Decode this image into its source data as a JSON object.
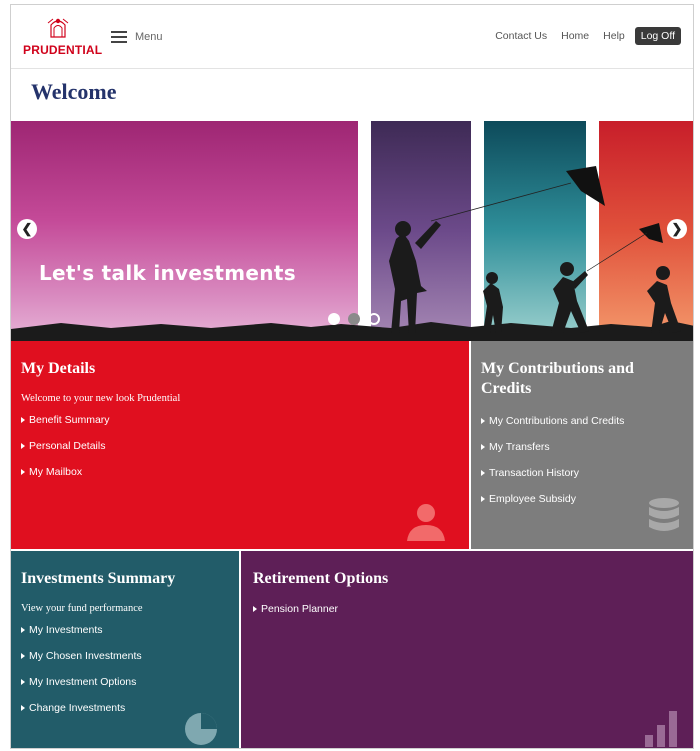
{
  "header": {
    "logo_text": "PRUDENTIAL",
    "menu_label": "Menu",
    "nav": [
      "Contact Us",
      "Home",
      "Help"
    ],
    "logoff_label": "Log Off"
  },
  "page_title": "Welcome",
  "banner": {
    "text": "Let's talk investments",
    "prev_icon": "arrow-left-circle-icon",
    "next_icon": "arrow-right-circle-icon"
  },
  "tiles": {
    "my_details": {
      "title": "My Details",
      "intro": "Welcome to your new look Prudential",
      "links": [
        "Benefit Summary",
        "Personal Details",
        "My Mailbox"
      ],
      "icon": "user-icon"
    },
    "contributions": {
      "title": "My Contributions and Credits",
      "links": [
        "My Contributions and Credits",
        "My Transfers",
        "Transaction History",
        "Employee Subsidy"
      ],
      "icon": "database-icon"
    },
    "investments": {
      "title": "Investments Summary",
      "intro": "View your fund performance",
      "links": [
        "My Investments",
        "My Chosen Investments",
        "My Investment Options",
        "Change Investments"
      ],
      "icon": "pie-chart-icon"
    },
    "retirement": {
      "title": "Retirement Options",
      "links": [
        "Pension Planner"
      ],
      "icon": "bar-chart-icon"
    }
  },
  "colors": {
    "brand_red": "#d0021b",
    "title_navy": "#24336b",
    "details_red": "#e00f1f",
    "contrib_gray": "#7d7d7d",
    "invest_teal": "#225c69",
    "retire_purple": "#5e1f57"
  }
}
